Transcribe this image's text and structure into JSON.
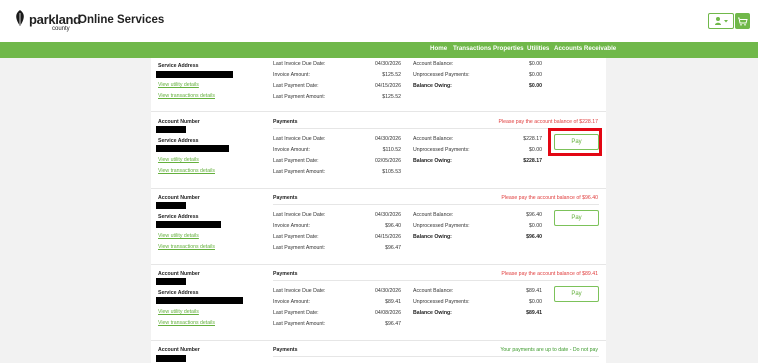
{
  "brand": {
    "name": "parkland",
    "sub": "county",
    "app_title": "Online Services"
  },
  "nav": [
    "Home",
    "Transactions",
    "Properties",
    "Utilities",
    "Accounts Receivable"
  ],
  "labels": {
    "account_number": "Account Number",
    "service_address": "Service Address",
    "payments": "Payments",
    "view_utility": "View utility details",
    "view_transactions": "View transactions details",
    "last_invoice_due": "Last Invoice Due Date:",
    "invoice_amount": "Invoice Amount:",
    "last_payment_date": "Last Payment Date:",
    "last_payment_amount": "Last Payment Amount:",
    "account_balance": "Account Balance:",
    "unprocessed_payments": "Unprocessed Payments:",
    "balance_owing": "Balance Owing:",
    "pay": "Pay"
  },
  "accounts": [
    {
      "notice": "",
      "last_invoice_due": "04/30/2026",
      "invoice_amount": "$125.52",
      "last_payment_date": "04/15/2026",
      "last_payment_amount": "$125.52",
      "account_balance": "$0.00",
      "unprocessed_payments": "$0.00",
      "balance_owing": "$0.00"
    },
    {
      "notice": "Please pay the account balance of $228.17",
      "last_invoice_due": "04/30/2026",
      "invoice_amount": "$110.52",
      "last_payment_date": "02/05/2026",
      "last_payment_amount": "$105.53",
      "account_balance": "$228.17",
      "unprocessed_payments": "$0.00",
      "balance_owing": "$228.17"
    },
    {
      "notice": "Please pay the account balance of $96.40",
      "last_invoice_due": "04/30/2026",
      "invoice_amount": "$96.40",
      "last_payment_date": "04/15/2026",
      "last_payment_amount": "$96.47",
      "account_balance": "$96.40",
      "unprocessed_payments": "$0.00",
      "balance_owing": "$96.40"
    },
    {
      "notice": "Please pay the account balance of $89.41",
      "last_invoice_due": "04/30/2026",
      "invoice_amount": "$89.41",
      "last_payment_date": "04/08/2026",
      "last_payment_amount": "$96.47",
      "account_balance": "$89.41",
      "unprocessed_payments": "$0.00",
      "balance_owing": "$89.41"
    },
    {
      "notice": "Your payments are up to date - Do not pay"
    }
  ],
  "colors": {
    "accent": "#70b84a",
    "alert": "#e03b3b",
    "highlight": "#e30613"
  }
}
